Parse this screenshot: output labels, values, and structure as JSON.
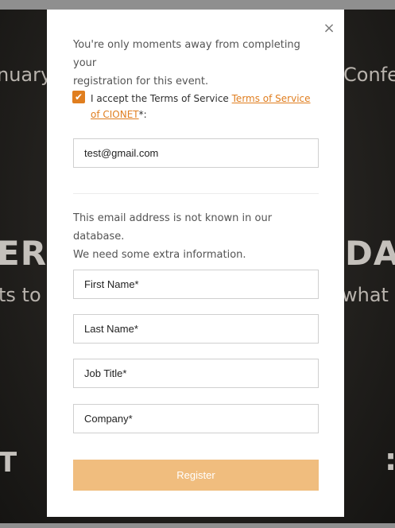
{
  "background": {
    "text_top_left": "nuary",
    "text_top_right": "Confe",
    "text_mid_left": "ER",
    "text_mid_right": "DAT",
    "text_sub_left": "ts to",
    "text_sub_right": "what l",
    "text_bottom_left": "T",
    "text_bottom_right": ":"
  },
  "modal": {
    "close_glyph": "×",
    "intro_line1": "You're only moments away from completing your",
    "intro_line2": "registration for this event.",
    "terms": {
      "checked": true,
      "check_glyph": "✔",
      "prefix": "I accept the Terms of Service ",
      "link_text": "Terms of Service of CIONET",
      "suffix": "*:"
    },
    "email_value": "test@gmail.com",
    "notice_line1": "This email address is not known in our database.",
    "notice_line2": "We need some extra information.",
    "fields": {
      "first_name": "First Name*",
      "last_name": "Last Name*",
      "job_title": "Job Title*",
      "company": "Company*"
    },
    "register_label": "Register"
  },
  "colors": {
    "accent": "#e07e1f",
    "button_bg": "#f0bd7e",
    "overlay_bar": "#8f8f8f"
  }
}
